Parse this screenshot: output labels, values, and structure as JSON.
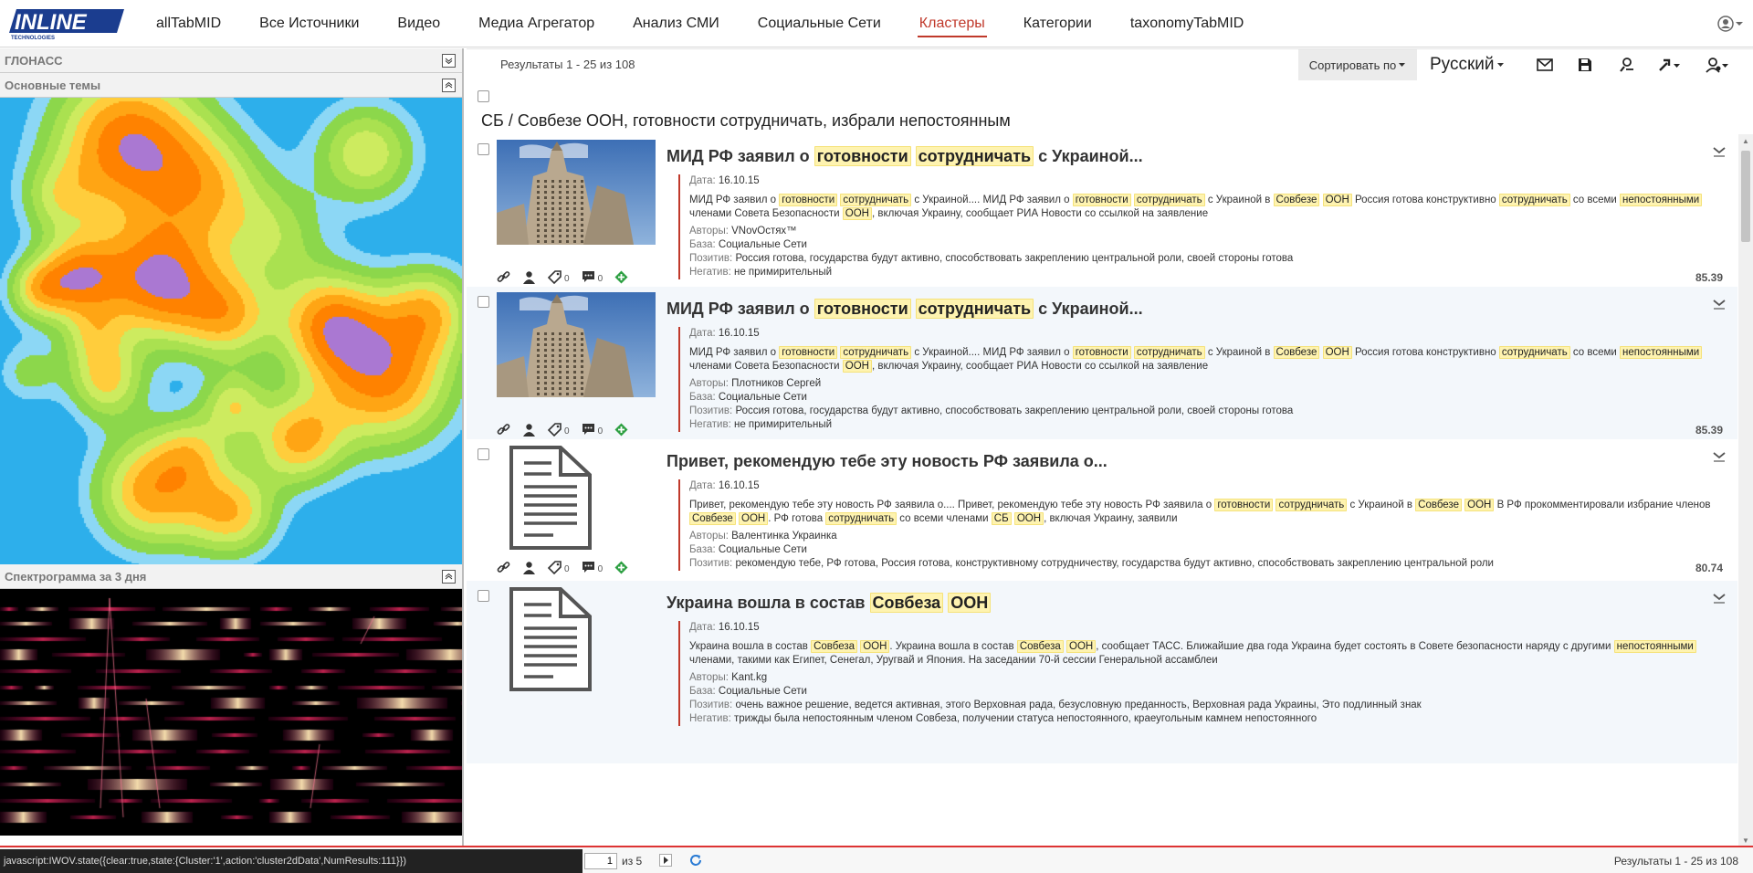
{
  "brand": {
    "logo_text": "INLINE",
    "logo_sub": "TECHNOLOGIES"
  },
  "nav": [
    {
      "label": "allTabMID"
    },
    {
      "label": "Все Источники"
    },
    {
      "label": "Видео"
    },
    {
      "label": "Медиа Агрегатор"
    },
    {
      "label": "Анализ СМИ"
    },
    {
      "label": "Социальные Сети"
    },
    {
      "label": "Кластеры",
      "active": true
    },
    {
      "label": "Категории"
    },
    {
      "label": "taxonomyTabMID"
    }
  ],
  "left": {
    "sections": [
      {
        "title": "ГЛОНАСС",
        "state": "collapsed"
      },
      {
        "title": "Основные темы",
        "state": "expanded"
      },
      {
        "title": "Спектрограмма за 3 дня",
        "state": "expanded"
      }
    ]
  },
  "toolbar": {
    "results": "Результаты 1 - 25 из 108",
    "sort_label": "Сортировать по",
    "language": "Русский",
    "icons": [
      "mail-icon",
      "save-icon",
      "user-search-icon",
      "share-icon",
      "user-settings-icon"
    ]
  },
  "cluster_title": "СБ / Совбезе ООН, готовности сотрудничать, избрали непостоянным",
  "labels": {
    "date": "Дата:",
    "authors": "Авторы:",
    "base": "База:",
    "positive": "Позитив:",
    "negative": "Негатив:"
  },
  "results": [
    {
      "title_parts": [
        [
          "МИД РФ заявил о ",
          0
        ],
        [
          "готовности",
          1
        ],
        [
          " ",
          0
        ],
        [
          "сотрудничать",
          1
        ],
        [
          " с Украиной...",
          0
        ]
      ],
      "date": "16.10.15",
      "snippet_parts": [
        [
          "МИД РФ заявил о ",
          0
        ],
        [
          "готовности",
          1
        ],
        [
          " ",
          0
        ],
        [
          "сотрудничать",
          1
        ],
        [
          " с Украиной.... МИД РФ заявил о ",
          0
        ],
        [
          "готовности",
          1
        ],
        [
          " ",
          0
        ],
        [
          "сотрудничать",
          1
        ],
        [
          " с Украиной в ",
          0
        ],
        [
          "Совбезе",
          1
        ],
        [
          " ",
          0
        ],
        [
          "ООН",
          1
        ],
        [
          " Россия готова конструктивно ",
          0
        ],
        [
          "сотрудничать",
          1
        ],
        [
          " со всеми ",
          0
        ],
        [
          "непостоянными",
          1
        ],
        [
          " членами Совета Безопасности ",
          0
        ],
        [
          "ООН",
          1
        ],
        [
          ", включая Украину, сообщает РИА Новости со ссылкой на заявление",
          0
        ]
      ],
      "authors": "VNovОстях™",
      "base": "Социальные Сети",
      "positive": "Россия готова, государства будут активно, способствовать закреплению центральной роли, своей стороны готова",
      "negative": "не примирительный",
      "links": "",
      "comments": "0",
      "tags": "0",
      "score": "85.39",
      "thumb": "photo"
    },
    {
      "title_parts": [
        [
          "МИД РФ заявил о ",
          0
        ],
        [
          "готовности",
          1
        ],
        [
          " ",
          0
        ],
        [
          "сотрудничать",
          1
        ],
        [
          " с Украиной...",
          0
        ]
      ],
      "date": "16.10.15",
      "snippet_parts": [
        [
          "МИД РФ заявил о ",
          0
        ],
        [
          "готовности",
          1
        ],
        [
          " ",
          0
        ],
        [
          "сотрудничать",
          1
        ],
        [
          " с Украиной.... МИД РФ заявил о ",
          0
        ],
        [
          "готовности",
          1
        ],
        [
          " ",
          0
        ],
        [
          "сотрудничать",
          1
        ],
        [
          " с Украиной в ",
          0
        ],
        [
          "Совбезе",
          1
        ],
        [
          " ",
          0
        ],
        [
          "ООН",
          1
        ],
        [
          " Россия готова конструктивно ",
          0
        ],
        [
          "сотрудничать",
          1
        ],
        [
          " со всеми ",
          0
        ],
        [
          "непостоянными",
          1
        ],
        [
          " членами Совета Безопасности ",
          0
        ],
        [
          "ООН",
          1
        ],
        [
          ", включая Украину, сообщает РИА Новости со ссылкой на заявление",
          0
        ]
      ],
      "authors": "Плотников Сергей",
      "base": "Социальные Сети",
      "positive": "Россия готова, государства будут активно, способствовать закреплению центральной роли, своей стороны готова",
      "negative": "не примирительный",
      "comments": "0",
      "tags": "0",
      "score": "85.39",
      "thumb": "photo"
    },
    {
      "title_parts": [
        [
          "Привет, рекомендую тебе эту новость РФ заявила о...",
          0
        ]
      ],
      "date": "16.10.15",
      "snippet_parts": [
        [
          "Привет, рекомендую тебе эту новость РФ заявила о.... Привет, рекомендую тебе эту новость РФ заявила о ",
          0
        ],
        [
          "готовности",
          1
        ],
        [
          " ",
          0
        ],
        [
          "сотрудничать",
          1
        ],
        [
          " с Украиной в ",
          0
        ],
        [
          "Совбезе",
          1
        ],
        [
          " ",
          0
        ],
        [
          "ООН",
          1
        ],
        [
          " В РФ прокомментировали избрание членов ",
          0
        ],
        [
          "Совбезе",
          1
        ],
        [
          " ",
          0
        ],
        [
          "ООН",
          1
        ],
        [
          ". РФ готова ",
          0
        ],
        [
          "сотрудничать",
          1
        ],
        [
          " со всеми членами ",
          0
        ],
        [
          "СБ",
          1
        ],
        [
          " ",
          0
        ],
        [
          "ООН",
          1
        ],
        [
          ", включая Украину, заявили",
          0
        ]
      ],
      "authors": "Валентинка Украинка",
      "base": "Социальные Сети",
      "positive": "рекомендую тебе, РФ готова, Россия готова, конструктивному сотрудничеству, государства будут активно, способствовать закреплению центральной роли",
      "negative": "",
      "comments": "0",
      "tags": "0",
      "score": "80.74",
      "thumb": "document"
    },
    {
      "title_parts": [
        [
          "Украина вошла в состав ",
          0
        ],
        [
          "Совбеза",
          1
        ],
        [
          " ",
          0
        ],
        [
          "ООН",
          1
        ]
      ],
      "date": "16.10.15",
      "snippet_parts": [
        [
          "Украина вошла в состав ",
          0
        ],
        [
          "Совбеза",
          1
        ],
        [
          " ",
          0
        ],
        [
          "ООН",
          1
        ],
        [
          ". Украина вошла в состав ",
          0
        ],
        [
          "Совбеза",
          1
        ],
        [
          " ",
          0
        ],
        [
          "ООН",
          1
        ],
        [
          ", сообщает ТАСС. Ближайшие два года Украина будет состоять в Совете безопасности наряду с другими ",
          0
        ],
        [
          "непостоянными",
          1
        ],
        [
          " членами, такими как Египет, Сенегал, Уругвай и Япония. На заседании 70-й сессии Генеральной ассамблеи",
          0
        ]
      ],
      "authors": "Kant.kg",
      "base": "Социальные Сети",
      "positive": "очень важное решение, ведется активная, этого Верховная рада, безусловную преданность, Верховная рада Украины, Это подлинный знак",
      "negative": "трижды была непостоянным членом Совбеза, получении статуса непостоянного, краеугольным камнем непостоянного",
      "comments": "",
      "tags": "",
      "score": "",
      "thumb": "document"
    }
  ],
  "bottom": {
    "status_url": "javascript:IWOV.state({clear:true,state:{Cluster:'1',action:'cluster2dData',NumResults:111}})",
    "page_value": "1",
    "page_of": "из 5",
    "results": "Результаты 1 - 25 из 108"
  },
  "colors": {
    "accent": "#c0392b",
    "highlight": "#fef3b0",
    "heat_water": "#1da8e6",
    "heat_low": "#8fd94a",
    "heat_high": "#ff8a00",
    "heat_peak": "#a070d0"
  }
}
